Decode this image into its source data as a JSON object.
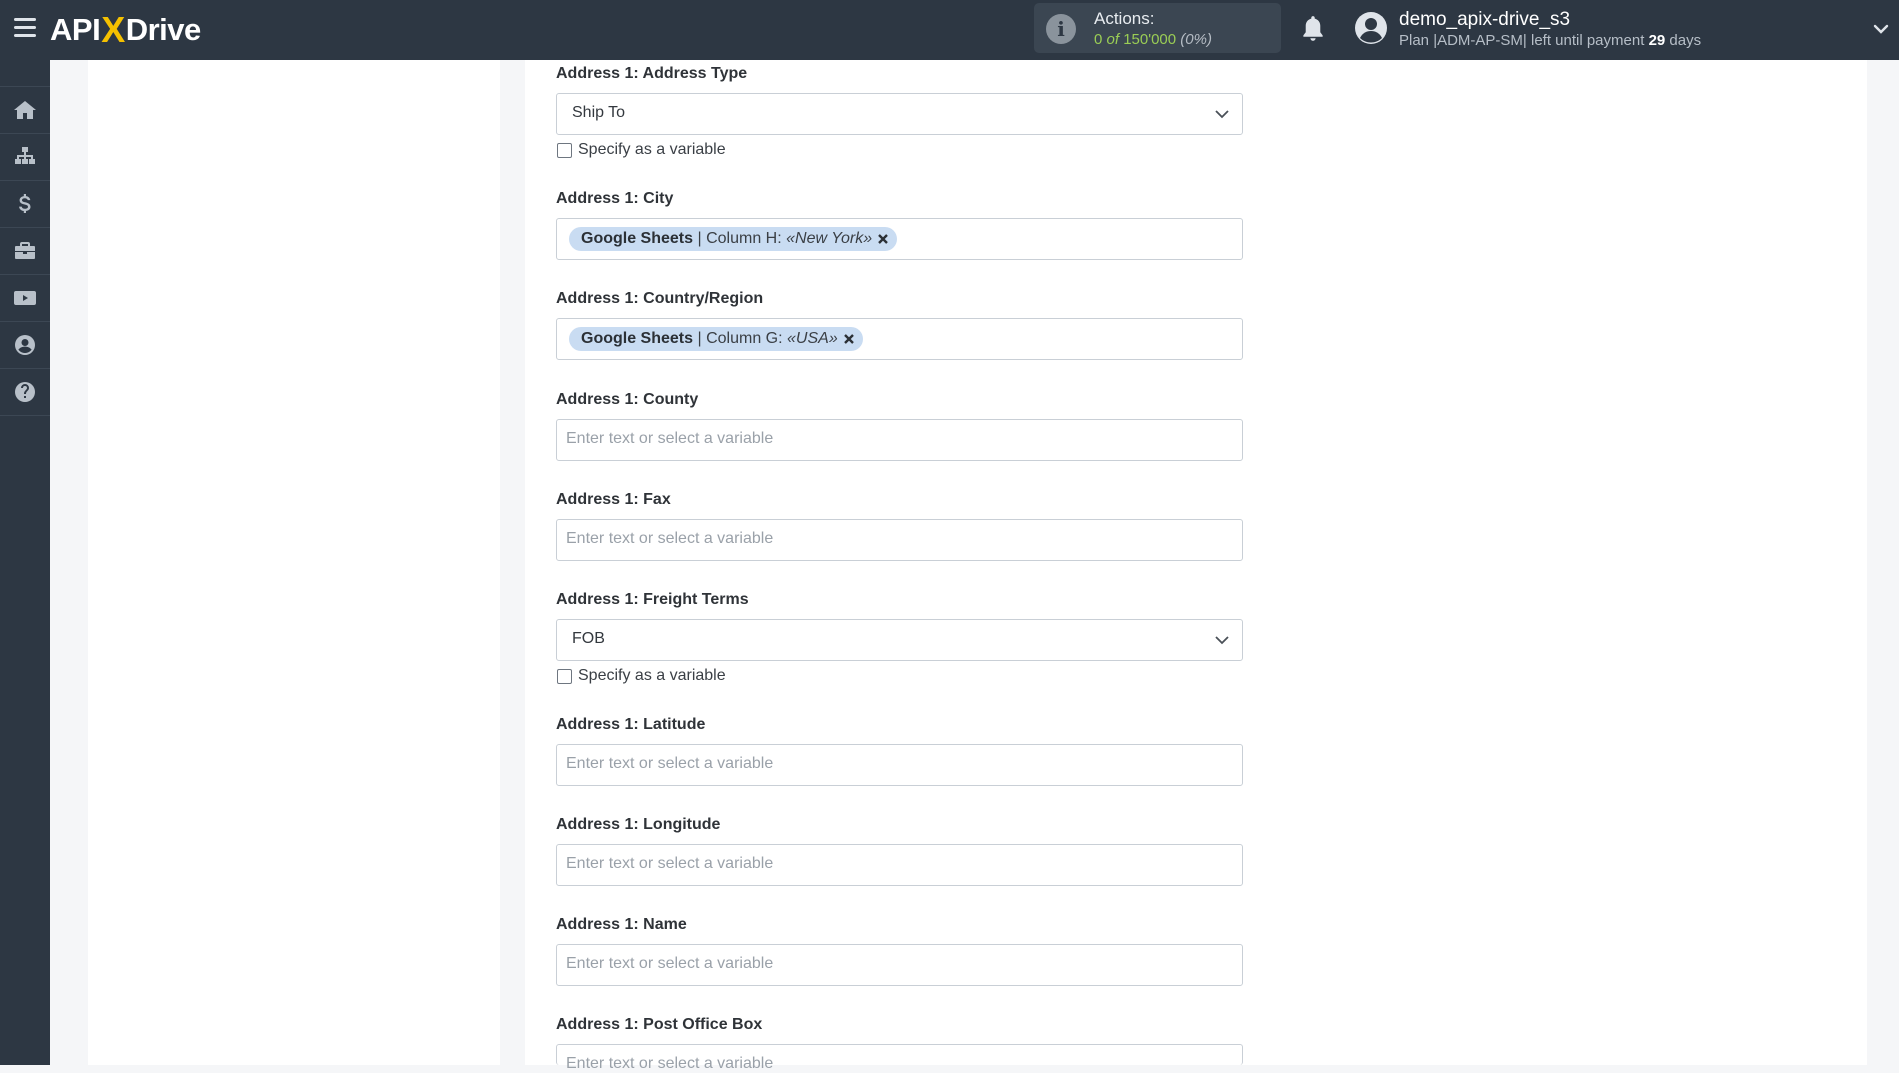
{
  "header": {
    "logo_api": "API",
    "logo_x": "X",
    "logo_drive": "Drive",
    "actions_label": "Actions:",
    "actions_used": "0",
    "actions_of": "of",
    "actions_total": "150'000",
    "actions_pct": "(0%)",
    "user_name": "demo_apix-drive_s3",
    "plan_prefix": "Plan |ADM-AP-SM| left until payment",
    "plan_days": "29",
    "plan_suffix": "days"
  },
  "sidebar": {
    "items": [
      "home-icon",
      "sitemap-icon",
      "dollar-icon",
      "briefcase-icon",
      "youtube-icon",
      "user-circle-icon",
      "help-icon"
    ]
  },
  "form": {
    "address_type": {
      "label": "Address 1: Address Type",
      "value": "Ship To",
      "checkbox": "Specify as a variable"
    },
    "city": {
      "label": "Address 1: City",
      "tag_source": "Google Sheets",
      "tag_column": "| Column H:",
      "tag_value": "«New York»"
    },
    "country": {
      "label": "Address 1: Country/Region",
      "tag_source": "Google Sheets",
      "tag_column": "| Column G:",
      "tag_value": "«USA»"
    },
    "county": {
      "label": "Address 1: County",
      "placeholder": "Enter text or select a variable"
    },
    "fax": {
      "label": "Address 1: Fax",
      "placeholder": "Enter text or select a variable"
    },
    "freight_terms": {
      "label": "Address 1: Freight Terms",
      "value": "FOB",
      "checkbox": "Specify as a variable"
    },
    "latitude": {
      "label": "Address 1: Latitude",
      "placeholder": "Enter text or select a variable"
    },
    "longitude": {
      "label": "Address 1: Longitude",
      "placeholder": "Enter text or select a variable"
    },
    "name": {
      "label": "Address 1: Name",
      "placeholder": "Enter text or select a variable"
    },
    "po_box": {
      "label": "Address 1: Post Office Box",
      "placeholder": "Enter text or select a variable"
    }
  },
  "colors": {
    "topbar": "#2d3743",
    "accent_yellow": "#f5c100",
    "actions_green": "#9acd55",
    "tag_bg": "#c9dcf2"
  }
}
